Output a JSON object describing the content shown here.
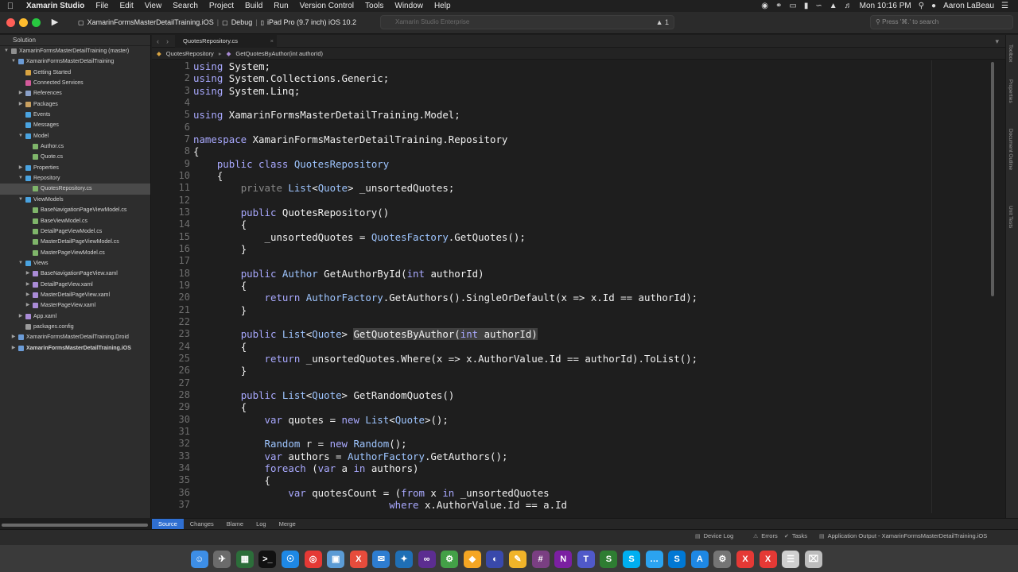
{
  "menubar": {
    "items": [
      "Xamarin Studio",
      "File",
      "Edit",
      "View",
      "Search",
      "Project",
      "Build",
      "Run",
      "Version Control",
      "Tools",
      "Window",
      "Help"
    ],
    "clock": "Mon 10:16 PM",
    "user": "Aaron LaBeau"
  },
  "toolbar": {
    "project": "XamarinFormsMasterDetailTraining.iOS",
    "config": "Debug",
    "device": "iPad Pro (9.7 inch) iOS 10.2",
    "status_text": "Xamarin Studio Enterprise",
    "warnings": "1",
    "search_placeholder": "Press '⌘.' to search"
  },
  "solution": {
    "header": "Solution",
    "items": [
      {
        "label": "XamarinFormsMasterDetailTraining (master)",
        "indent": 0,
        "arrow": "▼",
        "icon_color": "#8f8f8f",
        "selected": false
      },
      {
        "label": "XamarinFormsMasterDetailTraining",
        "indent": 1,
        "arrow": "▼",
        "icon_color": "#6b9bd6",
        "selected": false
      },
      {
        "label": "Getting Started",
        "indent": 2,
        "arrow": "",
        "icon_color": "#d9a441",
        "selected": false
      },
      {
        "label": "Connected Services",
        "indent": 2,
        "arrow": "",
        "icon_color": "#d45a9a",
        "selected": false
      },
      {
        "label": "References",
        "indent": 2,
        "arrow": "▶",
        "icon_color": "#8aa0c8",
        "selected": false
      },
      {
        "label": "Packages",
        "indent": 2,
        "arrow": "▶",
        "icon_color": "#c9a060",
        "selected": false
      },
      {
        "label": "Events",
        "indent": 2,
        "arrow": "",
        "icon_color": "#4aa3e0",
        "selected": false
      },
      {
        "label": "Messages",
        "indent": 2,
        "arrow": "",
        "icon_color": "#4aa3e0",
        "selected": false
      },
      {
        "label": "Model",
        "indent": 2,
        "arrow": "▼",
        "icon_color": "#4aa3e0",
        "selected": false
      },
      {
        "label": "Author.cs",
        "indent": 3,
        "arrow": "",
        "icon_color": "#7fb56a",
        "selected": false
      },
      {
        "label": "Quote.cs",
        "indent": 3,
        "arrow": "",
        "icon_color": "#7fb56a",
        "selected": false
      },
      {
        "label": "Properties",
        "indent": 2,
        "arrow": "▶",
        "icon_color": "#4aa3e0",
        "selected": false
      },
      {
        "label": "Repository",
        "indent": 2,
        "arrow": "▼",
        "icon_color": "#4aa3e0",
        "selected": false
      },
      {
        "label": "QuotesRepository.cs",
        "indent": 3,
        "arrow": "",
        "icon_color": "#7fb56a",
        "selected": true
      },
      {
        "label": "ViewModels",
        "indent": 2,
        "arrow": "▼",
        "icon_color": "#4aa3e0",
        "selected": false
      },
      {
        "label": "BaseNavigationPageViewModel.cs",
        "indent": 3,
        "arrow": "",
        "icon_color": "#7fb56a",
        "selected": false
      },
      {
        "label": "BaseViewModel.cs",
        "indent": 3,
        "arrow": "",
        "icon_color": "#7fb56a",
        "selected": false
      },
      {
        "label": "DetailPageViewModel.cs",
        "indent": 3,
        "arrow": "",
        "icon_color": "#7fb56a",
        "selected": false
      },
      {
        "label": "MasterDetailPageViewModel.cs",
        "indent": 3,
        "arrow": "",
        "icon_color": "#7fb56a",
        "selected": false
      },
      {
        "label": "MasterPageViewModel.cs",
        "indent": 3,
        "arrow": "",
        "icon_color": "#7fb56a",
        "selected": false
      },
      {
        "label": "Views",
        "indent": 2,
        "arrow": "▼",
        "icon_color": "#4aa3e0",
        "selected": false
      },
      {
        "label": "BaseNavigationPageView.xaml",
        "indent": 3,
        "arrow": "▶",
        "icon_color": "#a98bd6",
        "selected": false
      },
      {
        "label": "DetailPageView.xaml",
        "indent": 3,
        "arrow": "▶",
        "icon_color": "#a98bd6",
        "selected": false
      },
      {
        "label": "MasterDetailPageView.xaml",
        "indent": 3,
        "arrow": "▶",
        "icon_color": "#a98bd6",
        "selected": false
      },
      {
        "label": "MasterPageView.xaml",
        "indent": 3,
        "arrow": "▶",
        "icon_color": "#a98bd6",
        "selected": false
      },
      {
        "label": "App.xaml",
        "indent": 2,
        "arrow": "▶",
        "icon_color": "#a98bd6",
        "selected": false
      },
      {
        "label": "packages.config",
        "indent": 2,
        "arrow": "",
        "icon_color": "#9a9a9a",
        "selected": false
      },
      {
        "label": "XamarinFormsMasterDetailTraining.Droid",
        "indent": 1,
        "arrow": "▶",
        "icon_color": "#6b9bd6",
        "selected": false
      },
      {
        "label": "XamarinFormsMasterDetailTraining.iOS",
        "indent": 1,
        "arrow": "▶",
        "icon_color": "#6b9bd6",
        "selected": false,
        "bold": true
      }
    ]
  },
  "editor": {
    "tab": "QuotesRepository.cs",
    "breadcrumb": [
      "QuotesRepository",
      "GetQuotesByAuthor(int authorId)"
    ],
    "lines": [
      {
        "n": 1,
        "i": 0,
        "t": [
          [
            "using",
            "kw"
          ],
          [
            " System;",
            ""
          ]
        ]
      },
      {
        "n": 2,
        "i": 0,
        "t": [
          [
            "using",
            "kw"
          ],
          [
            " System.Collections.Generic;",
            ""
          ]
        ]
      },
      {
        "n": 3,
        "i": 0,
        "t": [
          [
            "using",
            "kw"
          ],
          [
            " System.Linq;",
            ""
          ]
        ]
      },
      {
        "n": 4,
        "i": 0,
        "t": []
      },
      {
        "n": 5,
        "i": 0,
        "t": [
          [
            "using",
            "kw"
          ],
          [
            " XamarinFormsMasterDetailTraining.Model;",
            ""
          ]
        ]
      },
      {
        "n": 6,
        "i": 0,
        "t": []
      },
      {
        "n": 7,
        "i": 0,
        "t": [
          [
            "namespace",
            "kw"
          ],
          [
            " XamarinFormsMasterDetailTraining.Repository",
            ""
          ]
        ]
      },
      {
        "n": 8,
        "i": 0,
        "t": [
          [
            "{",
            ""
          ]
        ]
      },
      {
        "n": 9,
        "i": 1,
        "t": [
          [
            "public class",
            "kw"
          ],
          [
            " ",
            ""
          ],
          [
            "QuotesRepository",
            "ty"
          ]
        ]
      },
      {
        "n": 10,
        "i": 1,
        "t": [
          [
            "{",
            ""
          ]
        ]
      },
      {
        "n": 11,
        "i": 2,
        "t": [
          [
            "private",
            "mu"
          ],
          [
            " ",
            ""
          ],
          [
            "List",
            "ty"
          ],
          [
            "<",
            ""
          ],
          [
            "Quote",
            "ty"
          ],
          [
            "> _unsortedQuotes;",
            ""
          ]
        ]
      },
      {
        "n": 12,
        "i": 0,
        "t": []
      },
      {
        "n": 13,
        "i": 2,
        "t": [
          [
            "public",
            "kw"
          ],
          [
            " QuotesRepository()",
            ""
          ]
        ]
      },
      {
        "n": 14,
        "i": 2,
        "t": [
          [
            "{",
            ""
          ]
        ]
      },
      {
        "n": 15,
        "i": 3,
        "t": [
          [
            "_unsortedQuotes = ",
            ""
          ],
          [
            "QuotesFactory",
            "ty"
          ],
          [
            ".GetQuotes();",
            ""
          ]
        ]
      },
      {
        "n": 16,
        "i": 2,
        "t": [
          [
            "}",
            ""
          ]
        ]
      },
      {
        "n": 17,
        "i": 0,
        "t": []
      },
      {
        "n": 18,
        "i": 2,
        "t": [
          [
            "public",
            "kw"
          ],
          [
            " ",
            ""
          ],
          [
            "Author",
            "ty"
          ],
          [
            " GetAuthorById(",
            ""
          ],
          [
            "int",
            "kw"
          ],
          [
            " authorId)",
            ""
          ]
        ]
      },
      {
        "n": 19,
        "i": 2,
        "t": [
          [
            "{",
            ""
          ]
        ]
      },
      {
        "n": 20,
        "i": 3,
        "t": [
          [
            "return",
            "kw"
          ],
          [
            " ",
            ""
          ],
          [
            "AuthorFactory",
            "ty"
          ],
          [
            ".GetAuthors().SingleOrDefault(x => x.Id == authorId);",
            ""
          ]
        ]
      },
      {
        "n": 21,
        "i": 2,
        "t": [
          [
            "}",
            ""
          ]
        ]
      },
      {
        "n": 22,
        "i": 0,
        "t": []
      },
      {
        "n": 23,
        "i": 2,
        "t": [
          [
            "public",
            "kw"
          ],
          [
            " ",
            ""
          ],
          [
            "List",
            "ty"
          ],
          [
            "<",
            ""
          ],
          [
            "Quote",
            "ty"
          ],
          [
            "> ",
            ""
          ],
          [
            "GetQuotesByAuthor(",
            "hl"
          ],
          [
            "int",
            "kw hl"
          ],
          [
            " authorId)",
            "hl"
          ]
        ]
      },
      {
        "n": 24,
        "i": 2,
        "t": [
          [
            "{",
            ""
          ]
        ]
      },
      {
        "n": 25,
        "i": 3,
        "t": [
          [
            "return",
            "kw"
          ],
          [
            " _unsortedQuotes.Where(x => x.AuthorValue.Id == authorId).ToList();",
            ""
          ]
        ]
      },
      {
        "n": 26,
        "i": 2,
        "t": [
          [
            "}",
            ""
          ]
        ]
      },
      {
        "n": 27,
        "i": 0,
        "t": []
      },
      {
        "n": 28,
        "i": 2,
        "t": [
          [
            "public",
            "kw"
          ],
          [
            " ",
            ""
          ],
          [
            "List",
            "ty"
          ],
          [
            "<",
            ""
          ],
          [
            "Quote",
            "ty"
          ],
          [
            "> GetRandomQuotes()",
            ""
          ]
        ]
      },
      {
        "n": 29,
        "i": 2,
        "t": [
          [
            "{",
            ""
          ]
        ]
      },
      {
        "n": 30,
        "i": 3,
        "t": [
          [
            "var",
            "kw"
          ],
          [
            " quotes = ",
            ""
          ],
          [
            "new",
            "kw"
          ],
          [
            " ",
            ""
          ],
          [
            "List",
            "ty"
          ],
          [
            "<",
            ""
          ],
          [
            "Quote",
            "ty"
          ],
          [
            ">();",
            ""
          ]
        ]
      },
      {
        "n": 31,
        "i": 0,
        "t": []
      },
      {
        "n": 32,
        "i": 3,
        "t": [
          [
            "Random",
            "ty"
          ],
          [
            " r = ",
            ""
          ],
          [
            "new",
            "kw"
          ],
          [
            " ",
            ""
          ],
          [
            "Random",
            "ty"
          ],
          [
            "();",
            ""
          ]
        ]
      },
      {
        "n": 33,
        "i": 3,
        "t": [
          [
            "var",
            "kw"
          ],
          [
            " authors = ",
            ""
          ],
          [
            "AuthorFactory",
            "ty"
          ],
          [
            ".GetAuthors();",
            ""
          ]
        ]
      },
      {
        "n": 34,
        "i": 3,
        "t": [
          [
            "foreach",
            "kw"
          ],
          [
            " (",
            ""
          ],
          [
            "var",
            "kw"
          ],
          [
            " a ",
            ""
          ],
          [
            "in",
            "kw"
          ],
          [
            " authors)",
            ""
          ]
        ]
      },
      {
        "n": 35,
        "i": 3,
        "t": [
          [
            "{",
            ""
          ]
        ]
      },
      {
        "n": 36,
        "i": 4,
        "t": [
          [
            "var",
            "kw"
          ],
          [
            " quotesCount = (",
            ""
          ],
          [
            "from",
            "kw"
          ],
          [
            " x ",
            ""
          ],
          [
            "in",
            "kw"
          ],
          [
            " _unsortedQuotes",
            ""
          ]
        ]
      },
      {
        "n": 37,
        "i": 4,
        "pad": "                 ",
        "t": [
          [
            "where",
            "kw"
          ],
          [
            " x.AuthorValue.Id == a.Id",
            ""
          ]
        ]
      }
    ]
  },
  "right_pads": [
    "Toolbox",
    "Properties",
    "Document Outline",
    "Unit Tests"
  ],
  "editor_tabs": [
    "Source",
    "Changes",
    "Blame",
    "Log",
    "Merge"
  ],
  "pads": [
    "Device Log",
    "Errors",
    "Tasks",
    "Application Output - XamarinFormsMasterDetailTraining.iOS"
  ],
  "dock": [
    {
      "name": "finder-icon",
      "color": "#3d8ee6",
      "glyph": "☺"
    },
    {
      "name": "launchpad-icon",
      "color": "#6b6b6b",
      "glyph": "✈"
    },
    {
      "name": "mission-control-icon",
      "color": "#2c6e3a",
      "glyph": "▦"
    },
    {
      "name": "terminal-icon",
      "color": "#111111",
      "glyph": ">_"
    },
    {
      "name": "safari-icon",
      "color": "#1e88e5",
      "glyph": "☉"
    },
    {
      "name": "chrome-icon",
      "color": "#e53935",
      "glyph": "◎"
    },
    {
      "name": "preview-icon",
      "color": "#5b9bd5",
      "glyph": "▣"
    },
    {
      "name": "xamarin-icon",
      "color": "#e74c3c",
      "glyph": "X"
    },
    {
      "name": "mail-icon",
      "color": "#2e7dd1",
      "glyph": "✉"
    },
    {
      "name": "vscode-icon",
      "color": "#1f6fb5",
      "glyph": "✦"
    },
    {
      "name": "visual-studio-icon",
      "color": "#5c2d91",
      "glyph": "∞"
    },
    {
      "name": "android-icon",
      "color": "#43a047",
      "glyph": "⚙"
    },
    {
      "name": "sketch-icon",
      "color": "#f5a623",
      "glyph": "◆"
    },
    {
      "name": "game-center-icon",
      "color": "#3949ab",
      "glyph": "◐"
    },
    {
      "name": "notes-icon",
      "color": "#f0b429",
      "glyph": "✎"
    },
    {
      "name": "slack-icon",
      "color": "#7a3f82",
      "glyph": "#"
    },
    {
      "name": "onenote-icon",
      "color": "#7b1fa2",
      "glyph": "N"
    },
    {
      "name": "teams-icon",
      "color": "#5059c9",
      "glyph": "T"
    },
    {
      "name": "sheets-icon",
      "color": "#2e7d32",
      "glyph": "S"
    },
    {
      "name": "skype-icon",
      "color": "#00aff0",
      "glyph": "S"
    },
    {
      "name": "messages-icon",
      "color": "#2ba3f0",
      "glyph": "…"
    },
    {
      "name": "skype-business-icon",
      "color": "#0078d4",
      "glyph": "S"
    },
    {
      "name": "app-store-icon",
      "color": "#1e88e5",
      "glyph": "A"
    },
    {
      "name": "system-preferences-icon",
      "color": "#757575",
      "glyph": "⚙"
    },
    {
      "name": "xamarin-studio-icon",
      "color": "#e53935",
      "glyph": "X"
    },
    {
      "name": "xamarin-profiler-icon",
      "color": "#e53935",
      "glyph": "X"
    },
    {
      "name": "documents-icon",
      "color": "#cfcfcf",
      "glyph": "☰"
    },
    {
      "name": "trash-icon",
      "color": "#bdbdbd",
      "glyph": "⌧"
    }
  ]
}
